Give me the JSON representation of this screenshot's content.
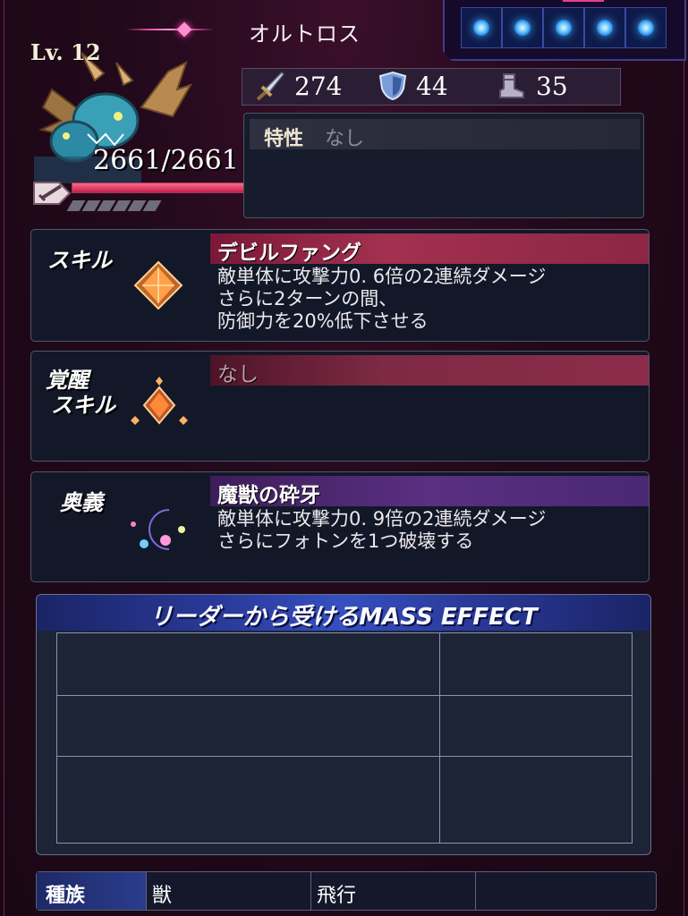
{
  "unit": {
    "name": "オルトロス",
    "level": "Lv. 12",
    "hp": "2661/2661",
    "hp_fill_fraction": 1.0
  },
  "slots": {
    "count": 5,
    "active_index": 2
  },
  "stats": {
    "attack": "274",
    "defense": "44",
    "speed": "35"
  },
  "trait": {
    "label": "特性",
    "value": "なし"
  },
  "skill": {
    "label": "スキル",
    "name": "デビルファング",
    "desc": [
      "敵単体に攻撃力0. 6倍の2連続ダメージ",
      "さらに2ターンの間、",
      "防御力を20%低下させる"
    ]
  },
  "awaken_skill": {
    "label_line1": "覚醒",
    "label_line2": "スキル",
    "name": "なし"
  },
  "ougi": {
    "label": "奥義",
    "name": "魔獣の砕牙",
    "desc": [
      "敵単体に攻撃力0. 9倍の2連続ダメージ",
      "さらにフォトンを1つ破壊する"
    ]
  },
  "mass_effect": {
    "title": "リーダーから受けるMASS EFFECT"
  },
  "race": {
    "label": "種族",
    "values": [
      "獣",
      "飛行",
      ""
    ]
  },
  "colors": {
    "accent_pink": "#e0409a",
    "orb_blue": "#39a8ff"
  }
}
